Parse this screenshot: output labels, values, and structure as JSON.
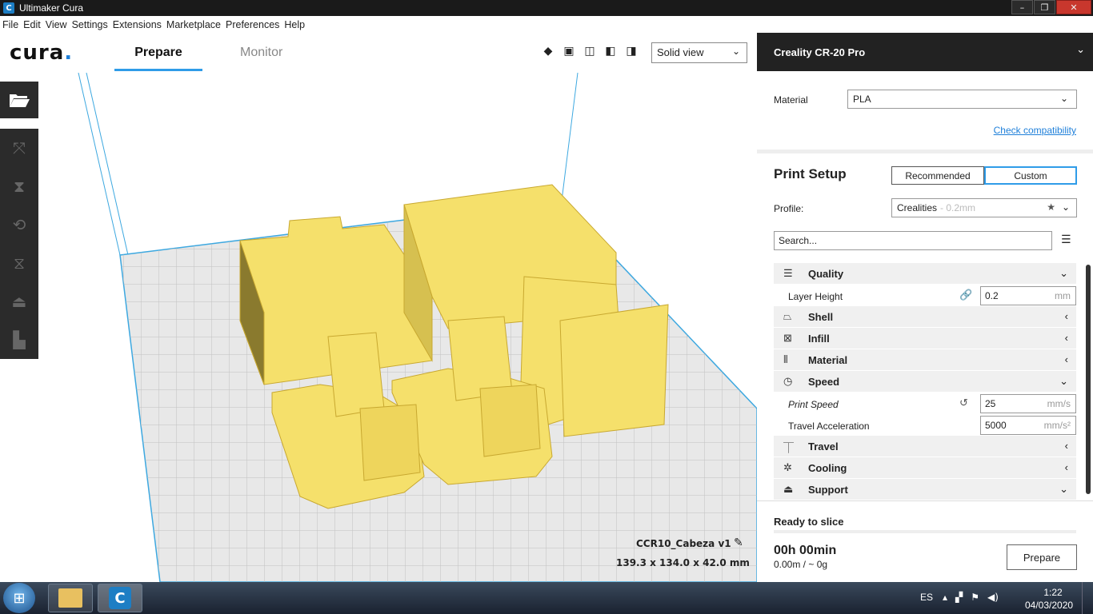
{
  "window": {
    "title": "Ultimaker Cura"
  },
  "menu": [
    "File",
    "Edit",
    "View",
    "Settings",
    "Extensions",
    "Marketplace",
    "Preferences",
    "Help"
  ],
  "header": {
    "logo": "cura",
    "tabs": {
      "prepare": "Prepare",
      "monitor": "Monitor"
    },
    "view_select": "Solid view",
    "view_icons": [
      "3d-view-icon",
      "front-view-icon",
      "top-view-icon",
      "left-view-icon",
      "right-view-icon"
    ]
  },
  "left_toolbar": {
    "open": "open-file-icon",
    "tools": [
      "move-icon",
      "scale-icon",
      "rotate-icon",
      "mirror-icon",
      "per-model-settings-icon",
      "support-blocker-icon"
    ]
  },
  "object": {
    "name": "CCR10_Cabeza v1",
    "dimensions": "139.3 x 134.0 x 42.0 mm"
  },
  "printer": {
    "name": "Creality CR-20 Pro"
  },
  "material": {
    "label": "Material",
    "value": "PLA",
    "check_compatibility": "Check compatibility"
  },
  "print_setup": {
    "title": "Print Setup",
    "recommended": "Recommended",
    "custom": "Custom",
    "profile_label": "Profile:",
    "profile_value": "Crealities",
    "profile_sub": "- 0.2mm",
    "search_placeholder": "Search..."
  },
  "settings": {
    "quality": {
      "label": "Quality",
      "icon": "quality-icon"
    },
    "layer_height": {
      "label": "Layer Height",
      "value": "0.2",
      "unit": "mm"
    },
    "shell": {
      "label": "Shell",
      "icon": "shell-icon"
    },
    "infill": {
      "label": "Infill",
      "icon": "infill-icon"
    },
    "material": {
      "label": "Material",
      "icon": "material-icon"
    },
    "speed": {
      "label": "Speed",
      "icon": "speed-icon"
    },
    "print_speed": {
      "label": "Print Speed",
      "value": "25",
      "unit": "mm/s"
    },
    "travel_accel": {
      "label": "Travel Acceleration",
      "value": "5000",
      "unit": "mm/s²"
    },
    "travel": {
      "label": "Travel",
      "icon": "travel-icon"
    },
    "cooling": {
      "label": "Cooling",
      "icon": "cooling-icon"
    },
    "support": {
      "label": "Support",
      "icon": "support-icon"
    }
  },
  "slice": {
    "status": "Ready to slice",
    "time": "00h 00min",
    "filament": "0.00m / ~ 0g",
    "prepare_button": "Prepare"
  },
  "taskbar": {
    "language": "ES",
    "time": "1:22",
    "date": "04/03/2020"
  },
  "colors": {
    "accent": "#2f9ce8",
    "model": "#f5e06b",
    "panel_dark": "#222222"
  }
}
